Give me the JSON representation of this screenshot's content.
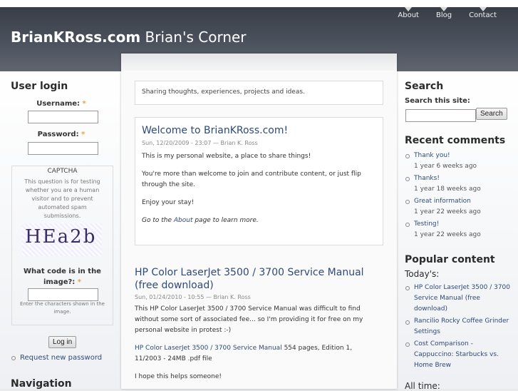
{
  "site": {
    "name": "BrianKRoss.com",
    "slogan": "Brian's Corner"
  },
  "nav": [
    "About",
    "Blog",
    "Contact"
  ],
  "login": {
    "title": "User login",
    "username_label": "Username:",
    "password_label": "Password:",
    "required_mark": "*",
    "captcha_legend": "CAPTCHA",
    "captcha_desc": "This question is for testing whether you are a human visitor and to prevent automated spam submissions.",
    "captcha_text": "HEa2b",
    "question_label": "What code is in the image?:",
    "question_help": "Enter the characters shown in the image.",
    "login_button": "Log in",
    "request_password": "Request new password"
  },
  "navigation_title": "Navigation",
  "mission": "Sharing thoughts, experiences, projects and ideas.",
  "posts": [
    {
      "title": "Welcome to BrianKRoss.com!",
      "meta": "Sun, 12/20/2009 - 23:07 — Brian K. Ross",
      "paragraphs": [
        "This is my personal website, a place to share things!",
        "You're more than welcome to join and contribute content, or just flip through the site.",
        "Enjoy your stay!"
      ],
      "about_prefix": "Go to the ",
      "about_link": "About",
      "about_suffix": " page to learn more."
    },
    {
      "title": "HP Color LaserJet 3500 / 3700 Service Manual (free download)",
      "meta": "Sun, 01/24/2010 - 10:55 — Brian K. Ross",
      "paragraphs": [
        "This HP Color LaserJet 3500 / 3700 Service Manual was difficult to find without some sort of associated fee... so I'm providing it for free on my personal website in protest :-)"
      ],
      "link": "HP Color LaserJet 3500 / 3700 Service Manual",
      "link_suffix": " 554 pages, Edition 1, 11/2003 - 24MB .pdf file",
      "closing": "I hope this helps someone!"
    }
  ],
  "search": {
    "title": "Search",
    "label": "Search this site:",
    "button": "Search",
    "value": ""
  },
  "recent_comments": {
    "title": "Recent comments",
    "items": [
      {
        "link": "Thank you!",
        "ago": "1 year 6 weeks ago"
      },
      {
        "link": "Thanks!",
        "ago": "1 year 18 weeks ago"
      },
      {
        "link": "Great information",
        "ago": "1 year 22 weeks ago"
      },
      {
        "link": "Testing!",
        "ago": "1 year 22 weeks ago"
      }
    ]
  },
  "popular": {
    "title": "Popular content",
    "today_label": "Today's:",
    "items": [
      "HP Color LaserJet 3500 / 3700 Service Manual (free download)",
      "Rancilio Rocky Coffee Grinder Settings",
      "Cost Comparison - Cappuccino: Starbucks vs. Home Brew"
    ],
    "alltime_label": "All time:"
  }
}
